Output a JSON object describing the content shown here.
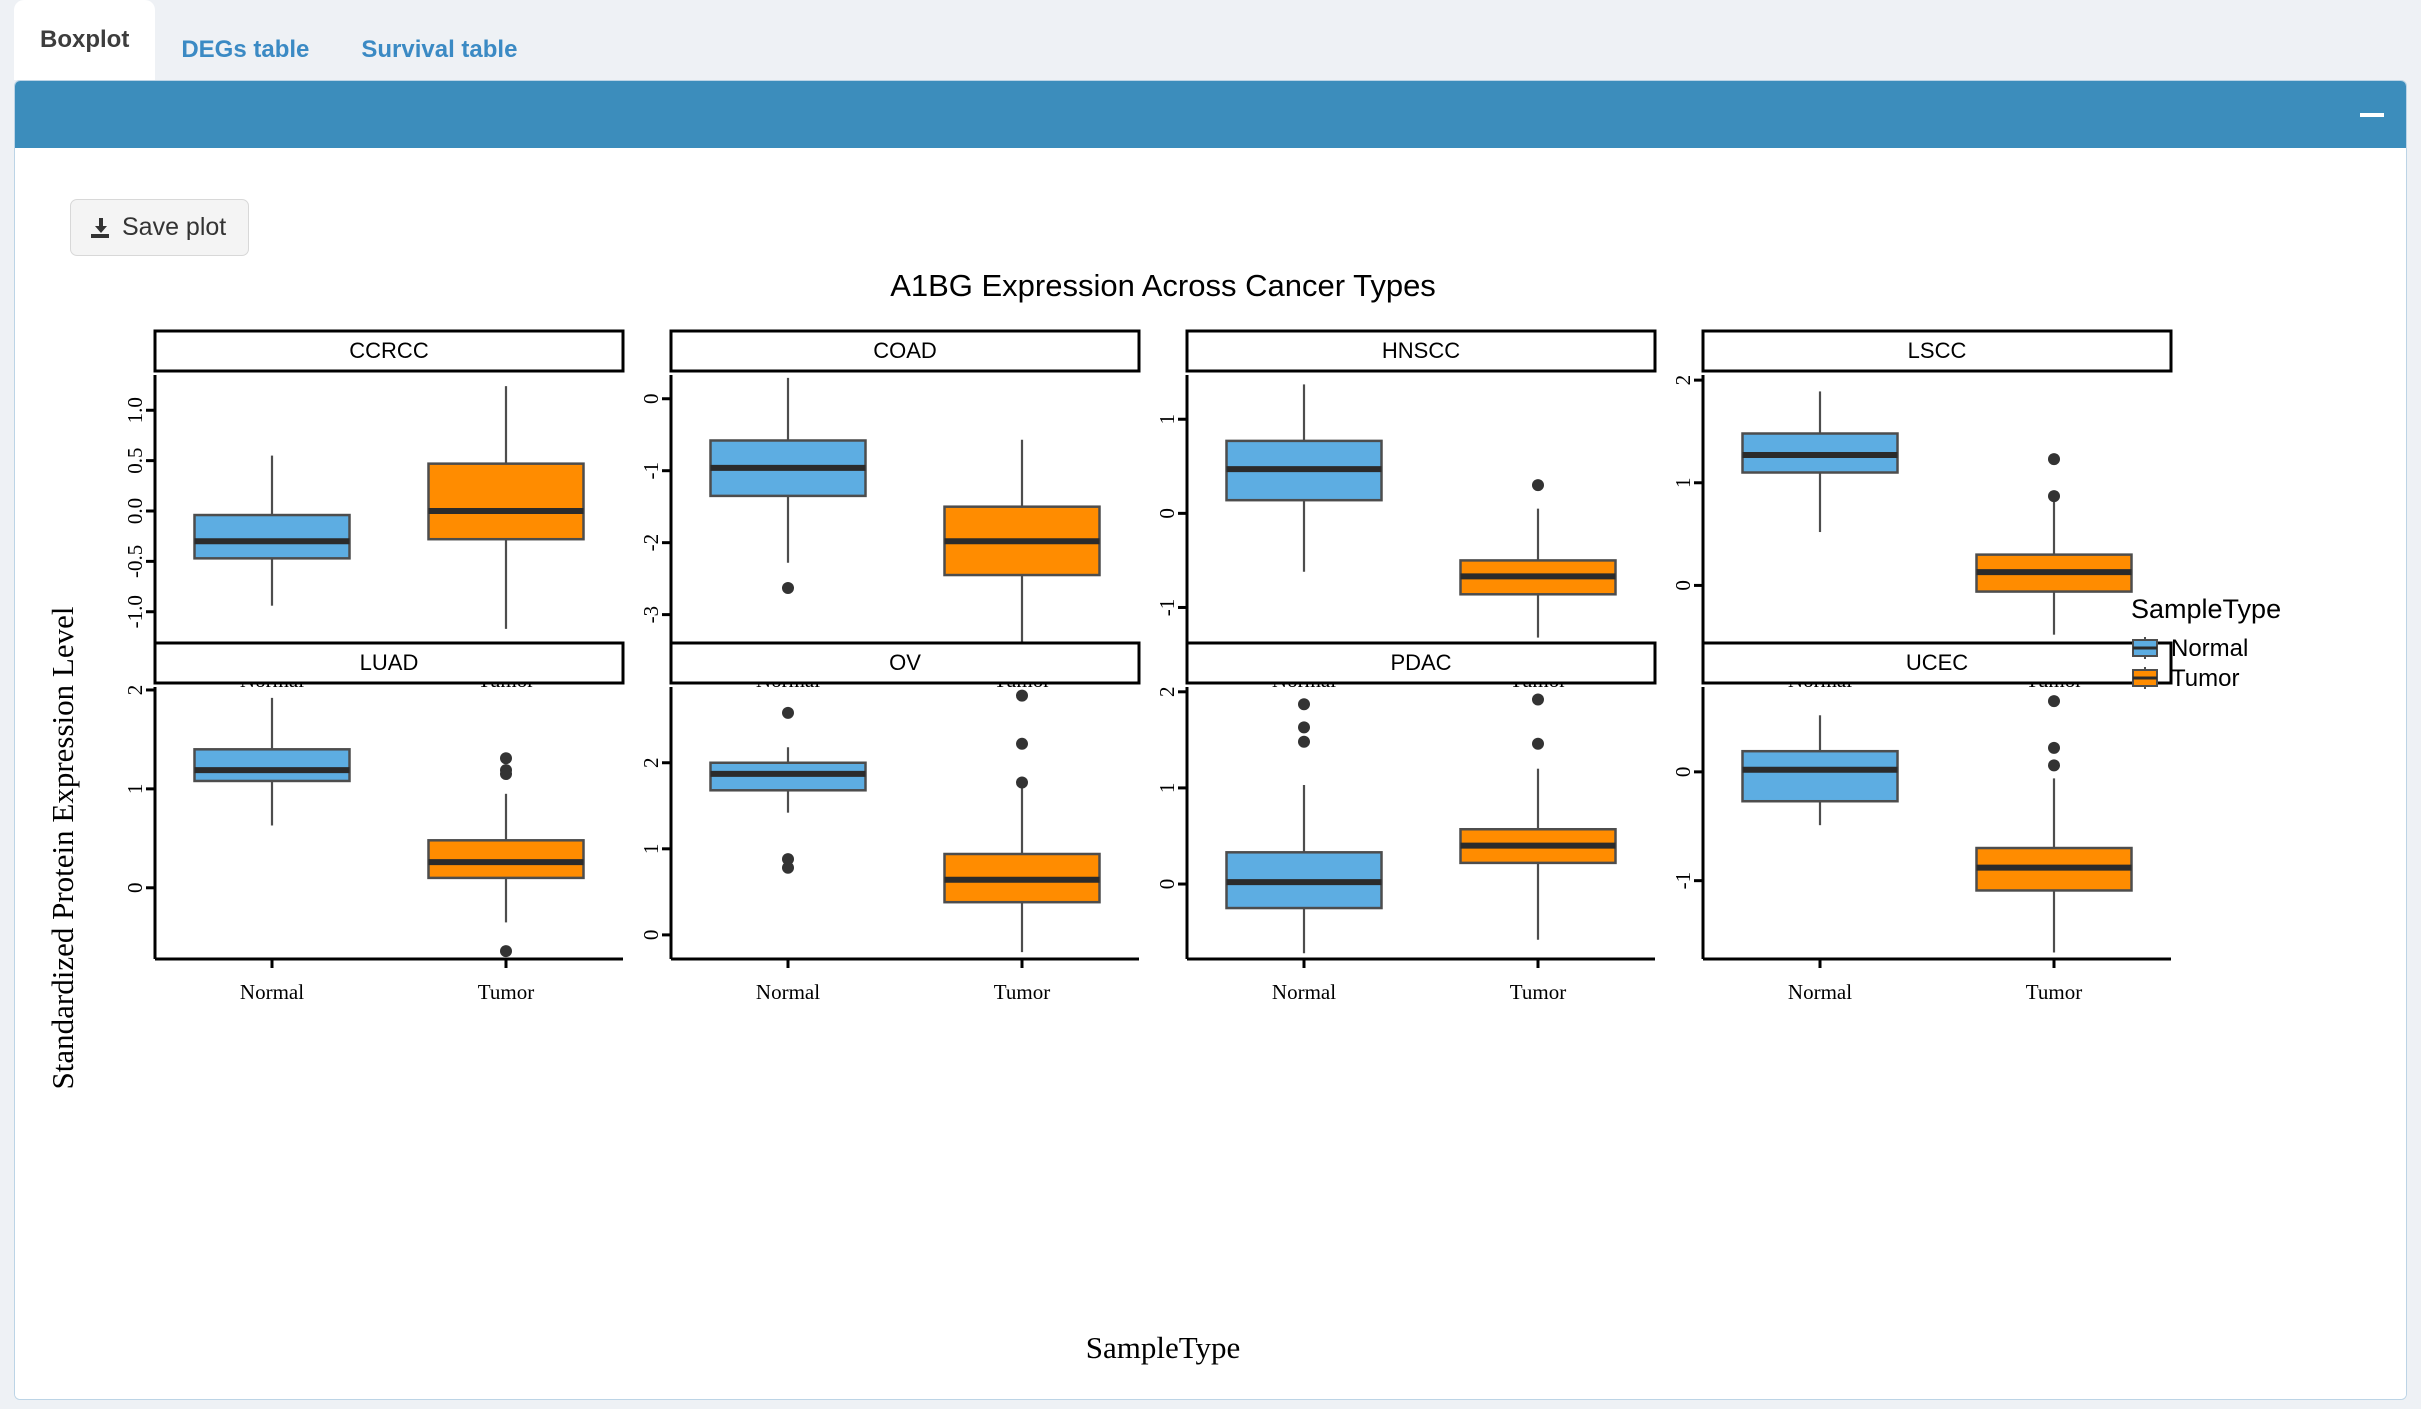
{
  "tabs": [
    {
      "label": "Boxplot",
      "active": true
    },
    {
      "label": "DEGs table",
      "active": false
    },
    {
      "label": "Survival table",
      "active": false
    }
  ],
  "card": {
    "header_accent": "#3c8dbc",
    "minimize_label": "–"
  },
  "toolbar": {
    "save_label": "Save plot",
    "save_icon": "download-icon"
  },
  "chart_data": {
    "type": "box",
    "title": "A1BG Expression Across Cancer Types",
    "xlabel": "SampleType",
    "ylabel": "Standardized Protein Expression Level",
    "grid": false,
    "legend": {
      "title": "SampleType",
      "position": "right",
      "entries": [
        {
          "label": "Normal",
          "color": "#5dade2"
        },
        {
          "label": "Tumor",
          "color": "#FF8C00"
        }
      ]
    },
    "categories": [
      "Normal",
      "Tumor"
    ],
    "colors": {
      "Normal": "#5dade2",
      "Tumor": "#FF8C00"
    },
    "facet_layout": {
      "rows": 2,
      "cols": 4
    },
    "panels": [
      {
        "name": "CCRCC",
        "ylim": [
          -1.35,
          1.35
        ],
        "yticks": [
          1.0,
          0.5,
          0.0,
          -0.5,
          -1.0
        ],
        "yticklabels": [
          "1.0",
          "0.5",
          "0.0",
          "-0.5",
          "-1.0"
        ],
        "boxes": [
          {
            "group": "Normal",
            "min": -0.94,
            "q1": -0.47,
            "median": -0.3,
            "q3": -0.04,
            "max": 0.55,
            "outliers": []
          },
          {
            "group": "Tumor",
            "min": -1.17,
            "q1": -0.28,
            "median": 0.0,
            "q3": 0.47,
            "max": 1.24,
            "outliers": []
          }
        ]
      },
      {
        "name": "COAD",
        "ylim": [
          -3.45,
          0.33
        ],
        "yticks": [
          0,
          -1,
          -2,
          -3
        ],
        "yticklabels": [
          "0",
          "-1",
          "-2",
          "-3"
        ],
        "boxes": [
          {
            "group": "Normal",
            "min": -2.28,
            "q1": -1.35,
            "median": -0.96,
            "q3": -0.58,
            "max": 0.29,
            "outliers": [
              -2.63
            ]
          },
          {
            "group": "Tumor",
            "min": -3.4,
            "q1": -2.45,
            "median": -1.98,
            "q3": -1.5,
            "max": -0.57,
            "outliers": []
          }
        ]
      },
      {
        "name": "HNSCC",
        "ylim": [
          -1.42,
          1.47
        ],
        "yticks": [
          1,
          0,
          -1
        ],
        "yticklabels": [
          "1",
          "0",
          "-1"
        ],
        "boxes": [
          {
            "group": "Normal",
            "min": -0.62,
            "q1": 0.14,
            "median": 0.47,
            "q3": 0.77,
            "max": 1.37,
            "outliers": []
          },
          {
            "group": "Tumor",
            "min": -1.32,
            "q1": -0.86,
            "median": -0.67,
            "q3": -0.5,
            "max": 0.05,
            "outliers": [
              0.3
            ]
          }
        ]
      },
      {
        "name": "LSCC",
        "ylim": [
          -0.6,
          2.05
        ],
        "yticks": [
          2,
          1,
          0
        ],
        "yticklabels": [
          "2",
          "1",
          "0"
        ],
        "boxes": [
          {
            "group": "Normal",
            "min": 0.52,
            "q1": 1.1,
            "median": 1.27,
            "q3": 1.48,
            "max": 1.89,
            "outliers": []
          },
          {
            "group": "Tumor",
            "min": -0.48,
            "q1": -0.06,
            "median": 0.13,
            "q3": 0.3,
            "max": 0.87,
            "outliers": [
              1.23,
              0.87
            ]
          }
        ]
      },
      {
        "name": "LUAD",
        "ylim": [
          -0.72,
          2.03
        ],
        "yticks": [
          2,
          1,
          0
        ],
        "yticklabels": [
          "2",
          "1",
          "0"
        ],
        "boxes": [
          {
            "group": "Normal",
            "min": 0.63,
            "q1": 1.08,
            "median": 1.19,
            "q3": 1.4,
            "max": 1.92,
            "outliers": []
          },
          {
            "group": "Tumor",
            "min": -0.35,
            "q1": 0.1,
            "median": 0.26,
            "q3": 0.48,
            "max": 0.95,
            "outliers": [
              1.31,
              1.19,
              1.15,
              -0.64
            ]
          }
        ]
      },
      {
        "name": "OV",
        "ylim": [
          -0.28,
          2.88
        ],
        "yticks": [
          2,
          1,
          0
        ],
        "yticklabels": [
          "2",
          "1",
          "0"
        ],
        "boxes": [
          {
            "group": "Normal",
            "min": 1.42,
            "q1": 1.68,
            "median": 1.87,
            "q3": 2.0,
            "max": 2.18,
            "outliers": [
              2.58,
              0.88,
              0.78
            ]
          },
          {
            "group": "Tumor",
            "min": -0.2,
            "q1": 0.38,
            "median": 0.64,
            "q3": 0.94,
            "max": 1.77,
            "outliers": [
              2.78,
              2.22,
              1.77
            ]
          }
        ]
      },
      {
        "name": "PDAC",
        "ylim": [
          -0.78,
          2.05
        ],
        "yticks": [
          2,
          1,
          0
        ],
        "yticklabels": [
          "2",
          "1",
          "0"
        ],
        "boxes": [
          {
            "group": "Normal",
            "min": -0.72,
            "q1": -0.25,
            "median": 0.02,
            "q3": 0.33,
            "max": 1.03,
            "outliers": [
              1.87,
              1.63,
              1.48
            ]
          },
          {
            "group": "Tumor",
            "min": -0.58,
            "q1": 0.22,
            "median": 0.4,
            "q3": 0.57,
            "max": 1.2,
            "outliers": [
              1.92,
              1.46
            ]
          }
        ]
      },
      {
        "name": "UCEC",
        "ylim": [
          -1.72,
          0.78
        ],
        "yticks": [
          0,
          -1
        ],
        "yticklabels": [
          "0",
          "-1"
        ],
        "boxes": [
          {
            "group": "Normal",
            "min": -0.49,
            "q1": -0.27,
            "median": 0.02,
            "q3": 0.19,
            "max": 0.52,
            "outliers": []
          },
          {
            "group": "Tumor",
            "min": -1.66,
            "q1": -1.09,
            "median": -0.88,
            "q3": -0.7,
            "max": -0.06,
            "outliers": [
              0.65,
              0.22,
              0.06
            ]
          }
        ]
      }
    ]
  }
}
